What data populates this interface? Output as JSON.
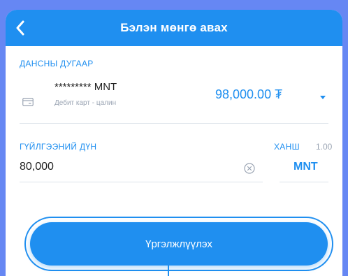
{
  "header": {
    "title": "Бэлэн мөнгө авах",
    "back_icon": "chevron-left-icon"
  },
  "account": {
    "label": "ДАНСНЫ ДУГААР",
    "number": "********* MNT",
    "type": "Дебит карт - цалин",
    "balance": "98,000.00 ₮",
    "icon": "card-icon",
    "dropdown_icon": "caret-down-icon"
  },
  "amount": {
    "label": "ГҮЙЛГЭЭНИЙ ДҮН",
    "value": "80,000",
    "clear_icon": "clear-icon"
  },
  "rate": {
    "label": "ХАНШ",
    "value": "1.00",
    "currency": "MNT"
  },
  "actions": {
    "continue_label": "Үргэлжлүүлэх"
  },
  "colors": {
    "accent": "#1f8ff0",
    "background": "#6687f3"
  }
}
